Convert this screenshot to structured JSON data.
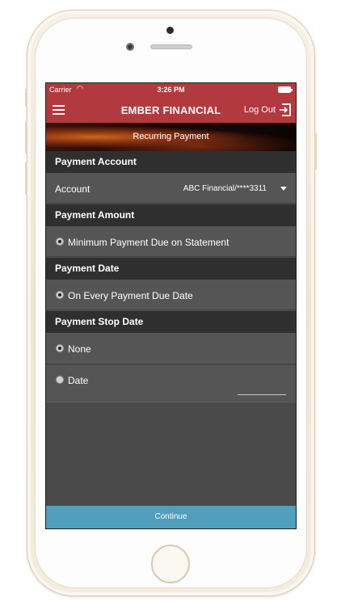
{
  "status_bar": {
    "carrier": "Carrier",
    "time": "3:26 PM"
  },
  "nav": {
    "title": "EMBER FINANCIAL",
    "logout_label": "Log Out"
  },
  "banner": {
    "title": "Recurring Payment"
  },
  "payment_account": {
    "header": "Payment Account",
    "account_label": "Account",
    "account_value": "ABC Financial/****3311"
  },
  "payment_amount": {
    "header": "Payment Amount",
    "option": "Minimum Payment Due on Statement"
  },
  "payment_date": {
    "header": "Payment Date",
    "option": "On Every Payment Due Date"
  },
  "payment_stop_date": {
    "header": "Payment Stop Date",
    "options": [
      "None",
      "Date"
    ]
  },
  "continue_label": "Continue",
  "colors": {
    "brand": "#b23a3e",
    "continue": "#4f9fbd",
    "header_bg": "#2f2f2f",
    "row_bg": "#555555"
  }
}
